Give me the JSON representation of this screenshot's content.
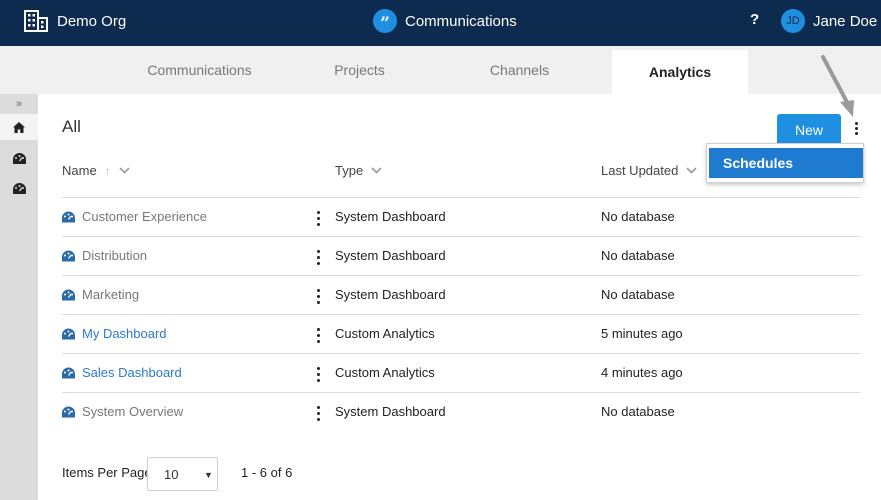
{
  "header": {
    "org_name": "Demo Org",
    "org_icon": "building-icon",
    "app_name": "Communications",
    "app_icon": "quote-icon",
    "app_icon_glyph": "”",
    "help_label": "?",
    "user_initials": "JD",
    "user_name": "Jane Doe"
  },
  "tabs": [
    {
      "label": "Communications",
      "active": false
    },
    {
      "label": "Projects",
      "active": false
    },
    {
      "label": "Channels",
      "active": false
    },
    {
      "label": "Analytics",
      "active": true
    }
  ],
  "sidebar": {
    "expand_glyph": "»",
    "items": [
      "home-icon",
      "dashboard-icon",
      "dashboard-icon"
    ]
  },
  "main": {
    "title": "All",
    "new_button": "New",
    "menu": {
      "item": "Schedules"
    },
    "columns": {
      "name": "Name",
      "type": "Type",
      "updated": "Last Updated"
    },
    "rows": [
      {
        "name": "Customer Experience",
        "type": "System Dashboard",
        "updated": "No database",
        "link": false
      },
      {
        "name": "Distribution",
        "type": "System Dashboard",
        "updated": "No database",
        "link": false
      },
      {
        "name": "Marketing",
        "type": "System Dashboard",
        "updated": "No database",
        "link": false
      },
      {
        "name": "My Dashboard",
        "type": "Custom Analytics",
        "updated": "5 minutes ago",
        "link": true
      },
      {
        "name": "Sales Dashboard",
        "type": "Custom Analytics",
        "updated": "4 minutes ago",
        "link": true
      },
      {
        "name": "System Overview",
        "type": "System Dashboard",
        "updated": "No database",
        "link": false
      }
    ]
  },
  "pagination": {
    "items_per_page_label": "Items Per Page",
    "items_per_page_value": "10",
    "range": "1 - 6 of 6"
  },
  "colors": {
    "header_bg": "#0d2b4e",
    "accent": "#1e8fe1",
    "link": "#2b7bc9"
  }
}
